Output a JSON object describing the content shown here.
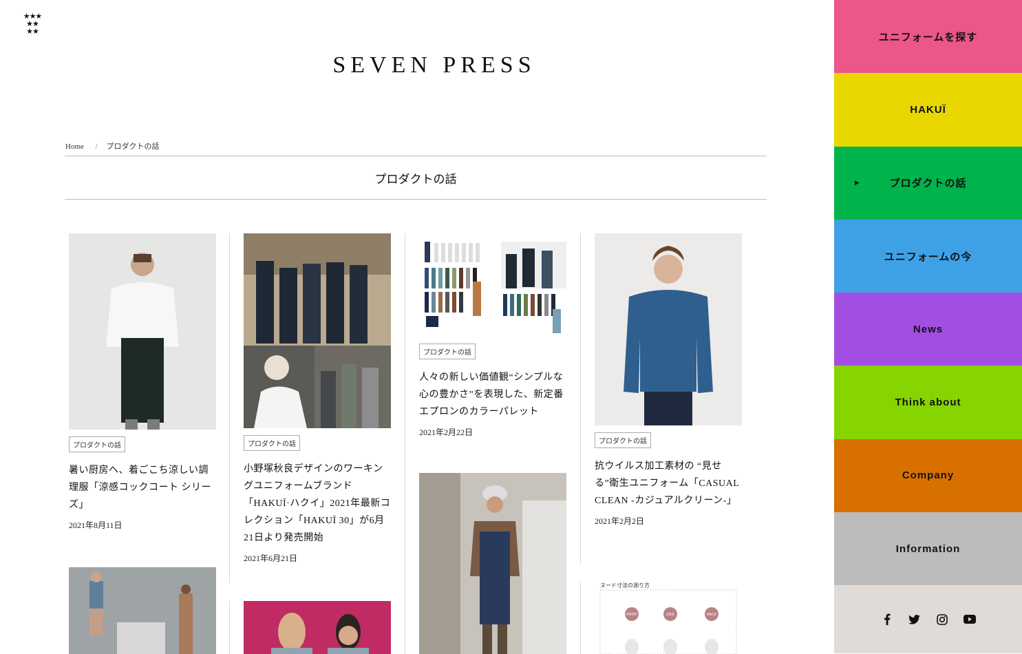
{
  "header": {
    "site_title": "SEVEN PRESS"
  },
  "breadcrumb": {
    "home": "Home",
    "separator": "/",
    "current": "プロダクトの話"
  },
  "page_title": "プロダクトの話",
  "articles": [
    {
      "tag": "プロダクトの話",
      "title": "暑い厨房へ、着ごこち涼しい調理服「涼感コックコート シリーズ」",
      "date": "2021年8月11日"
    },
    {
      "tag": "プロダクトの話",
      "title": "小野塚秋良デザインのワーキングユニフォームブランド「HAKUÏ·ハクイ」2021年最新コレクション「HAKUÏ 30」が6月21日より発売開始",
      "date": "2021年6月21日"
    },
    {
      "tag": "プロダクトの話",
      "title": "人々の新しい価値観“シンプルな心の豊かさ”を表現した、新定番エプロンのカラーパレット",
      "date": "2021年2月22日"
    },
    {
      "tag": "プロダクトの話",
      "title": "抗ウイルス加工素材の “見せる”衛生ユニフォーム「CASUAL CLEAN -カジュアルクリーン-」",
      "date": "2021年2月2日"
    }
  ],
  "nav": [
    {
      "label": "ユニフォームを探す",
      "color": "#ec568a"
    },
    {
      "label": "HAKUÏ",
      "color": "#e8d800"
    },
    {
      "label": "プロダクトの話",
      "color": "#00b34a",
      "active": true
    },
    {
      "label": "ユニフォームの今",
      "color": "#3ea1e5"
    },
    {
      "label": "News",
      "color": "#a34ee3"
    },
    {
      "label": "Think about",
      "color": "#86d400"
    },
    {
      "label": "Company",
      "color": "#d87000"
    },
    {
      "label": "Information",
      "color": "#bcbcbc"
    }
  ],
  "social": [
    "facebook-icon",
    "twitter-icon",
    "instagram-icon",
    "youtube-icon"
  ],
  "thumbnail_text": {
    "measure_title": "ヌード寸法の測り方",
    "front": "FRONT",
    "side": "SIDE",
    "back": "BACK"
  }
}
